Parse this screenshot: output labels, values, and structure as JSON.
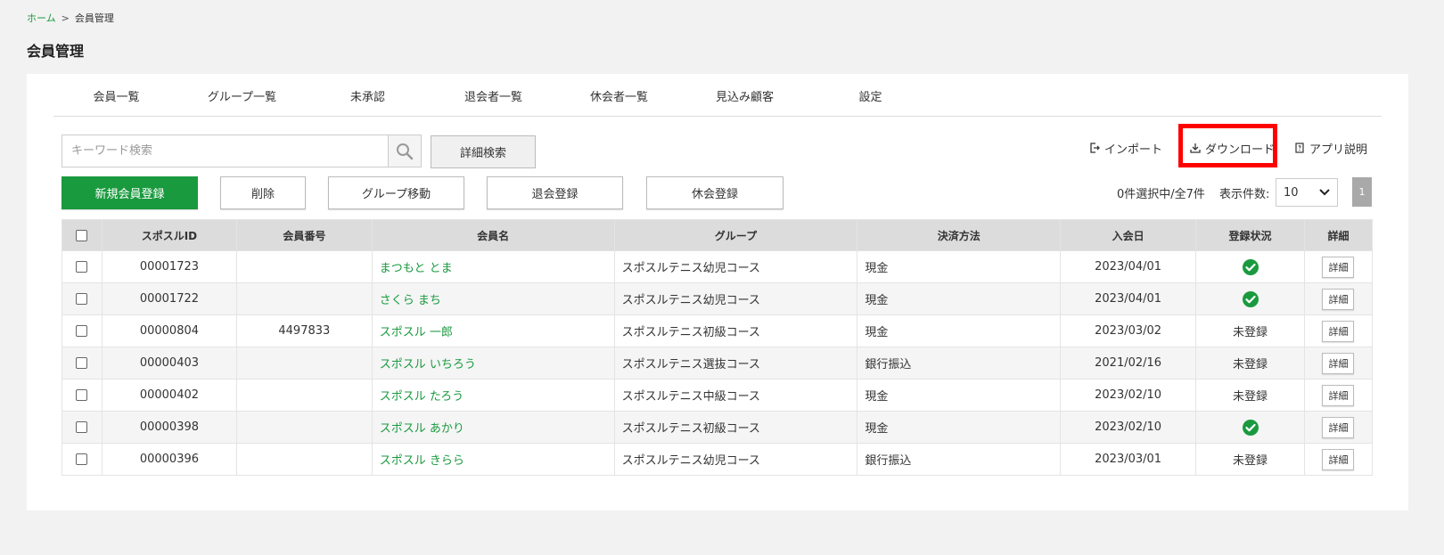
{
  "breadcrumb": {
    "home": "ホーム",
    "separator": ">",
    "current": "会員管理"
  },
  "page_title": "会員管理",
  "tabs": [
    {
      "label": "会員一覧",
      "active": true
    },
    {
      "label": "グループ一覧",
      "active": false
    },
    {
      "label": "未承認",
      "active": false
    },
    {
      "label": "退会者一覧",
      "active": false
    },
    {
      "label": "休会者一覧",
      "active": false
    },
    {
      "label": "見込み顧客",
      "active": false
    },
    {
      "label": "設定",
      "active": false
    }
  ],
  "search": {
    "placeholder": "キーワード検索",
    "value": "",
    "advanced_label": "詳細検索"
  },
  "top_links": {
    "import": "インポート",
    "download": "ダウンロード",
    "app_help": "アプリ説明"
  },
  "actions": {
    "new_member": "新規会員登録",
    "delete": "削除",
    "group_move": "グループ移動",
    "withdraw": "退会登録",
    "suspend": "休会登録"
  },
  "selection": {
    "count_text": "0件選択中/全7件"
  },
  "per_page": {
    "label": "表示件数:",
    "value": "10"
  },
  "pagination": {
    "current": "1"
  },
  "colors": {
    "accent": "#1a9a3f",
    "highlight": "#ff0000"
  },
  "table": {
    "headers": {
      "id": "スポスルID",
      "member_no": "会員番号",
      "name": "会員名",
      "group": "グループ",
      "payment": "決済方法",
      "join_date": "入会日",
      "status": "登録状況",
      "detail": "詳細"
    },
    "detail_label": "詳細",
    "rows": [
      {
        "id": "00001723",
        "member_no": "",
        "name": "まつもと とま",
        "group": "スポスルテニス幼児コース",
        "payment": "現金",
        "join_date": "2023/04/01",
        "registered": true,
        "status": ""
      },
      {
        "id": "00001722",
        "member_no": "",
        "name": "さくら まち",
        "group": "スポスルテニス幼児コース",
        "payment": "現金",
        "join_date": "2023/04/01",
        "registered": true,
        "status": ""
      },
      {
        "id": "00000804",
        "member_no": "4497833",
        "name": "スポスル 一郎",
        "group": "スポスルテニス初級コース",
        "payment": "現金",
        "join_date": "2023/03/02",
        "registered": false,
        "status": "未登録"
      },
      {
        "id": "00000403",
        "member_no": "",
        "name": "スポスル いちろう",
        "group": "スポスルテニス選抜コース",
        "payment": "銀行振込",
        "join_date": "2021/02/16",
        "registered": false,
        "status": "未登録"
      },
      {
        "id": "00000402",
        "member_no": "",
        "name": "スポスル たろう",
        "group": "スポスルテニス中級コース",
        "payment": "現金",
        "join_date": "2023/02/10",
        "registered": false,
        "status": "未登録"
      },
      {
        "id": "00000398",
        "member_no": "",
        "name": "スポスル あかり",
        "group": "スポスルテニス初級コース",
        "payment": "現金",
        "join_date": "2023/02/10",
        "registered": true,
        "status": ""
      },
      {
        "id": "00000396",
        "member_no": "",
        "name": "スポスル きらら",
        "group": "スポスルテニス幼児コース",
        "payment": "銀行振込",
        "join_date": "2023/03/01",
        "registered": false,
        "status": "未登録"
      }
    ]
  }
}
